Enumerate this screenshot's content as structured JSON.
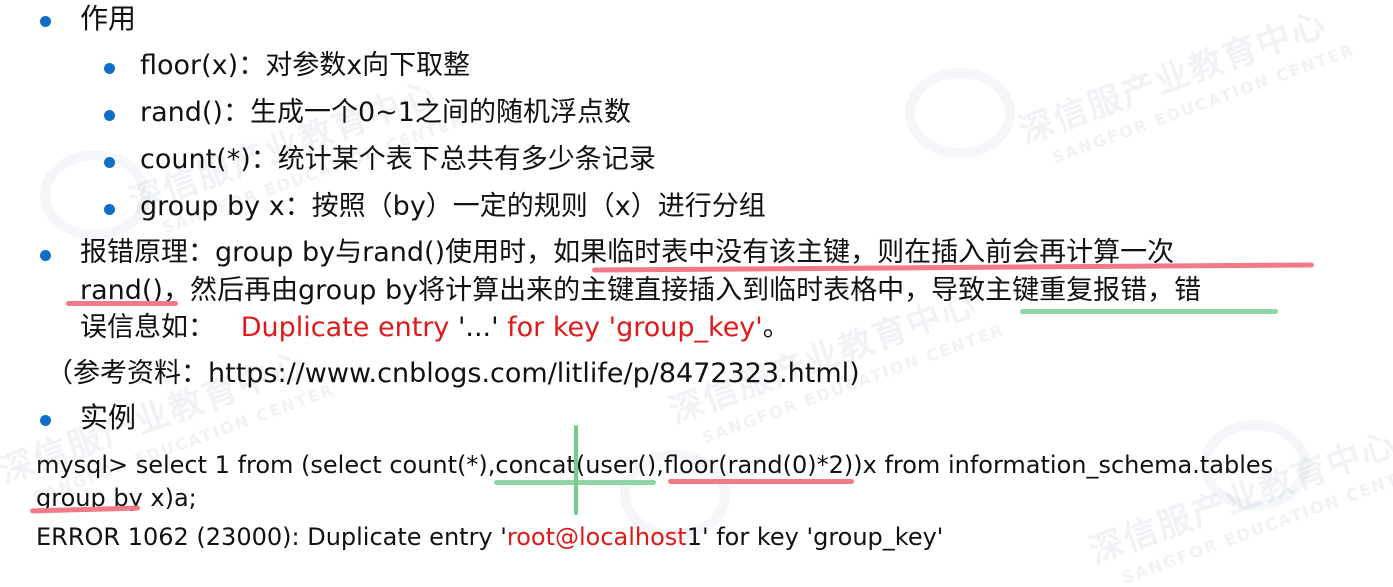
{
  "watermark": {
    "cn": "深信服产业教育中心",
    "en": "SANGFOR EDUCATION CENTER"
  },
  "section_usage": {
    "heading": "作用",
    "items": [
      "floor(x)：对参数x向下取整",
      "rand()：生成一个0~1之间的随机浮点数",
      "count(*)：统计某个表下总共有多少条记录",
      "group by x：按照（by）一定的规则（x）进行分组"
    ]
  },
  "section_principle": {
    "line1_prefix": "报错原理：group by与rand()使用时，",
    "line1_highlight": "如果临时表中没有该主键，则在插入前会再计算一次",
    "line2_highlight_start": "rand()",
    "line2_middle": "，然后再由group by将计算出来的主键直接插入到临时表格中，",
    "line2_highlight_end": "导致主键重复报错",
    "line2_suffix": "，错",
    "line3_prefix": "误信息如：",
    "line3_red_a": "Duplicate entry",
    "line3_middle": " '...' ",
    "line3_red_b": "for key 'group_key'",
    "line3_suffix": "。"
  },
  "reference": "（参考资料：https://www.cnblogs.com/litlife/p/8472323.html)",
  "section_example": {
    "heading": "实例",
    "code_line1_a": "mysql> select 1 from (select count(*),",
    "code_line1_b": "concat(user(),",
    "code_line1_c": "floor(rand(0)*2)",
    "code_line1_d": ")x from information_schema.tables",
    "code_line2": "group by x)a;",
    "error_prefix": "ERROR 1062 (23000): Duplicate entry '",
    "error_red": "root@localhost",
    "error_suffix": "1' for key 'group_key'"
  }
}
